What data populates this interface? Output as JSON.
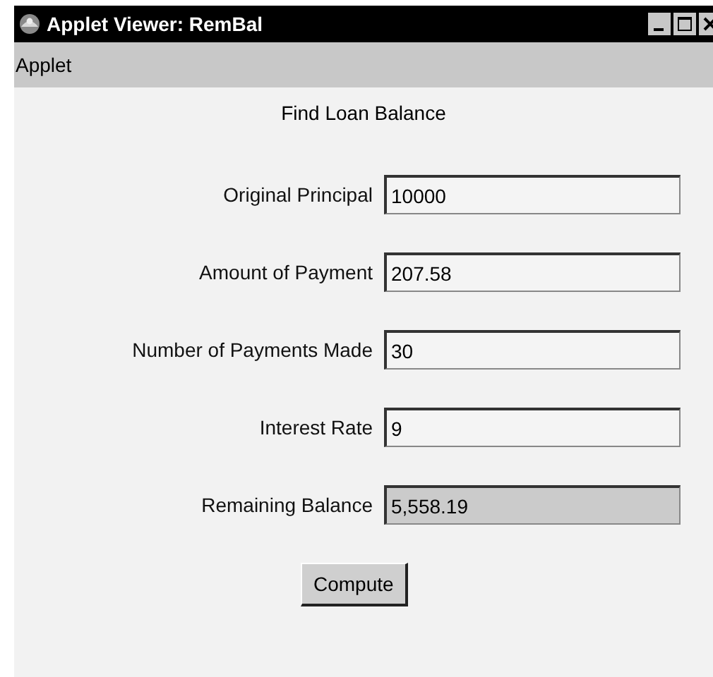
{
  "window": {
    "title": "Applet Viewer: RemBal"
  },
  "menu": [
    "Applet"
  ],
  "heading": "Find Loan Balance",
  "fields": [
    {
      "label": "Original Principal",
      "value": "10000",
      "editable": true
    },
    {
      "label": "Amount of Payment",
      "value": "207.58",
      "editable": true
    },
    {
      "label": "Number of Payments Made",
      "value": "30",
      "editable": true
    },
    {
      "label": "Interest Rate",
      "value": "9",
      "editable": true
    },
    {
      "label": "Remaining Balance",
      "value": "5,558.19",
      "editable": false
    }
  ],
  "buttons": [
    "Compute"
  ]
}
